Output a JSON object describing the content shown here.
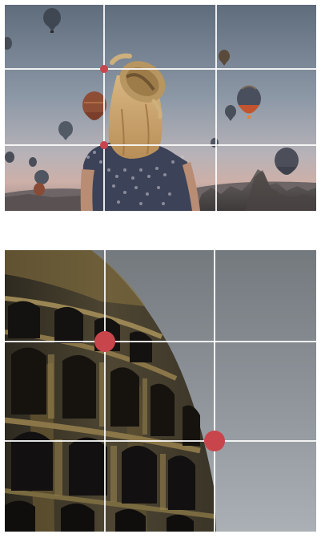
{
  "examples": [
    {
      "subject": "balloons",
      "grid": "3x3",
      "point_color": "#c9454c",
      "line_color": "#ffffff"
    },
    {
      "subject": "colosseum",
      "grid": "3x3",
      "point_color": "#c9454c",
      "line_color": "#ffffff"
    }
  ]
}
